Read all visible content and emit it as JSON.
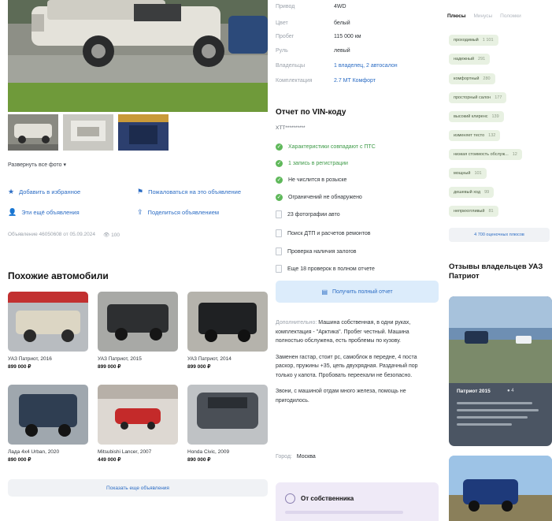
{
  "gallery": {
    "show_all_label": "Развернуть все фото"
  },
  "actions": {
    "favorite": "Добавить в избранное",
    "complain": "Пожаловаться на это объявление",
    "seller_ads": "Эти ещё объявления",
    "share": "Поделиться объявлением"
  },
  "meta": {
    "posted": "Объявление 46050608 от 05.09.2024",
    "views": "100"
  },
  "similar": {
    "title": "Похожие автомобили",
    "cars": [
      {
        "name": "УАЗ Патриот, 2016",
        "price": "899 000 ₽"
      },
      {
        "name": "УАЗ Патриот, 2015",
        "price": "899 000 ₽"
      },
      {
        "name": "УАЗ Патриот, 2014",
        "price": "899 000 ₽"
      },
      {
        "name": "Лада 4x4 Urban, 2020",
        "price": "890 000 ₽"
      },
      {
        "name": "Mitsubishi Lancer, 2007",
        "price": "449 000 ₽"
      },
      {
        "name": "Honda Civic, 2009",
        "price": "890 000 ₽"
      }
    ],
    "more_label": "Показать еще объявления"
  },
  "specs": [
    {
      "key": "Привод",
      "value": "4WD",
      "link": false
    },
    {
      "key": "Цвет",
      "value": "белый",
      "link": false
    },
    {
      "key": "Пробег",
      "value": "115 000 км",
      "link": false
    },
    {
      "key": "Руль",
      "value": "левый",
      "link": false
    },
    {
      "key": "Владельцы",
      "value": "1 владелец, 2 автосалон",
      "link": true
    },
    {
      "key": "Комплектация",
      "value": "2.7 MT Комфорт",
      "link": true
    }
  ],
  "vin_report": {
    "title": "Отчет по VIN-коду",
    "code": "XTT**********",
    "checks": [
      {
        "text": "Характеристики совпадают с ПТС",
        "ok": true
      },
      {
        "text": "1 запись в регистрации",
        "ok": true
      },
      {
        "text": "Не числится в розыске",
        "ok": true
      },
      {
        "text": "Ограничений не обнаружено",
        "ok": true
      },
      {
        "text": "23 фотографии авто",
        "ok": false
      },
      {
        "text": "Поиск ДТП и расчетов ремонтов",
        "ok": false
      },
      {
        "text": "Проверка наличия залогов",
        "ok": false
      },
      {
        "text": "Еще 18 проверок в полном отчете",
        "ok": false
      }
    ],
    "button_label": "Получить полный отчет"
  },
  "description": {
    "label": "Дополнительно:",
    "p1": "Машина собственная, в одни руках, комплектация - \"Арктика\". Пробег честный. Машина полностью обслужена, есть проблемы по кузову.",
    "p2": "Заменен гастар, стоит рс, самоблок в передне, 4 поста раскор, пружины +35, цепь двухрядная. Раздачный пор только у капота. Пробовать переехали не безопасно.",
    "p3": "Звони, с машиной отдам много железа, помощь не пригодилось.",
    "city_label": "Город:",
    "city": "Москва"
  },
  "owner_box": {
    "title": "От собственника"
  },
  "right": {
    "tabs": [
      "Плюсы",
      "Минусы",
      "Поломки"
    ],
    "chips": [
      {
        "label": "проходимый",
        "count": "1 101"
      },
      {
        "label": "надежный",
        "count": "291"
      },
      {
        "label": "комфортный",
        "count": "280"
      },
      {
        "label": "просторный салон",
        "count": "177"
      },
      {
        "label": "высокий клиренс",
        "count": "139"
      },
      {
        "label": "изменяет тесто",
        "count": "132"
      },
      {
        "label": "низкая стоимость обслуж...",
        "count": "12"
      },
      {
        "label": "мощный",
        "count": "101"
      },
      {
        "label": "дешевый ход",
        "count": "99"
      },
      {
        "label": "неприхотливый",
        "count": "81"
      }
    ],
    "chips_more": "4 700 оценочных плюсов",
    "reviews_title": "Отзывы владельцев УАЗ Патриот",
    "review": {
      "title": "Патриот 2015",
      "score": "4"
    }
  }
}
